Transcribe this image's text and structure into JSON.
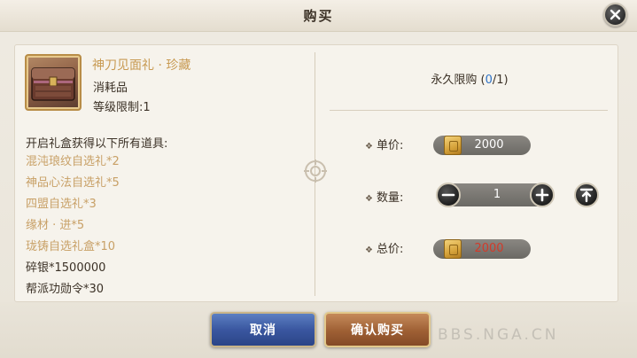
{
  "dialog": {
    "title": "购买",
    "close_icon": "close-icon"
  },
  "item": {
    "name": "神刀见面礼 · 珍藏",
    "type": "消耗品",
    "level_limit": "等级限制:1",
    "icon": "gift-chest-icon"
  },
  "gift": {
    "header": "开启礼盒获得以下所有道具:",
    "items": [
      {
        "label": "混沌琅纹自选礼*2",
        "color": "#c8a066"
      },
      {
        "label": "神品心法自选礼*5",
        "color": "#c8a066"
      },
      {
        "label": "四盟自选礼*3",
        "color": "#c8a066"
      },
      {
        "label": "缘材 · 进*5",
        "color": "#c8a066"
      },
      {
        "label": "珑铸自选礼盒*10",
        "color": "#c8a066"
      },
      {
        "label": "碎银*1500000",
        "color": "#3b3126"
      },
      {
        "label": "帮派功勋令*30",
        "color": "#3b3126"
      }
    ]
  },
  "purchase": {
    "limit_prefix": "永久限购 (",
    "limit_current": "0",
    "limit_suffix": "/1)",
    "unit_price_label": "单价:",
    "unit_price": "2000",
    "quantity_label": "数量:",
    "quantity": "1",
    "total_label": "总价:",
    "total_price": "2000",
    "currency_icon": "gold-ticket-icon"
  },
  "buttons": {
    "cancel": "取消",
    "confirm": "确认购买"
  },
  "watermark": "BBS.NGA.CN",
  "colors": {
    "gold_text": "#c89a52",
    "accent_blue": "#2f72c6",
    "price_red": "#d23a2a",
    "cancel_blue": "#3a57a0",
    "confirm_brown": "#9e5f34"
  }
}
